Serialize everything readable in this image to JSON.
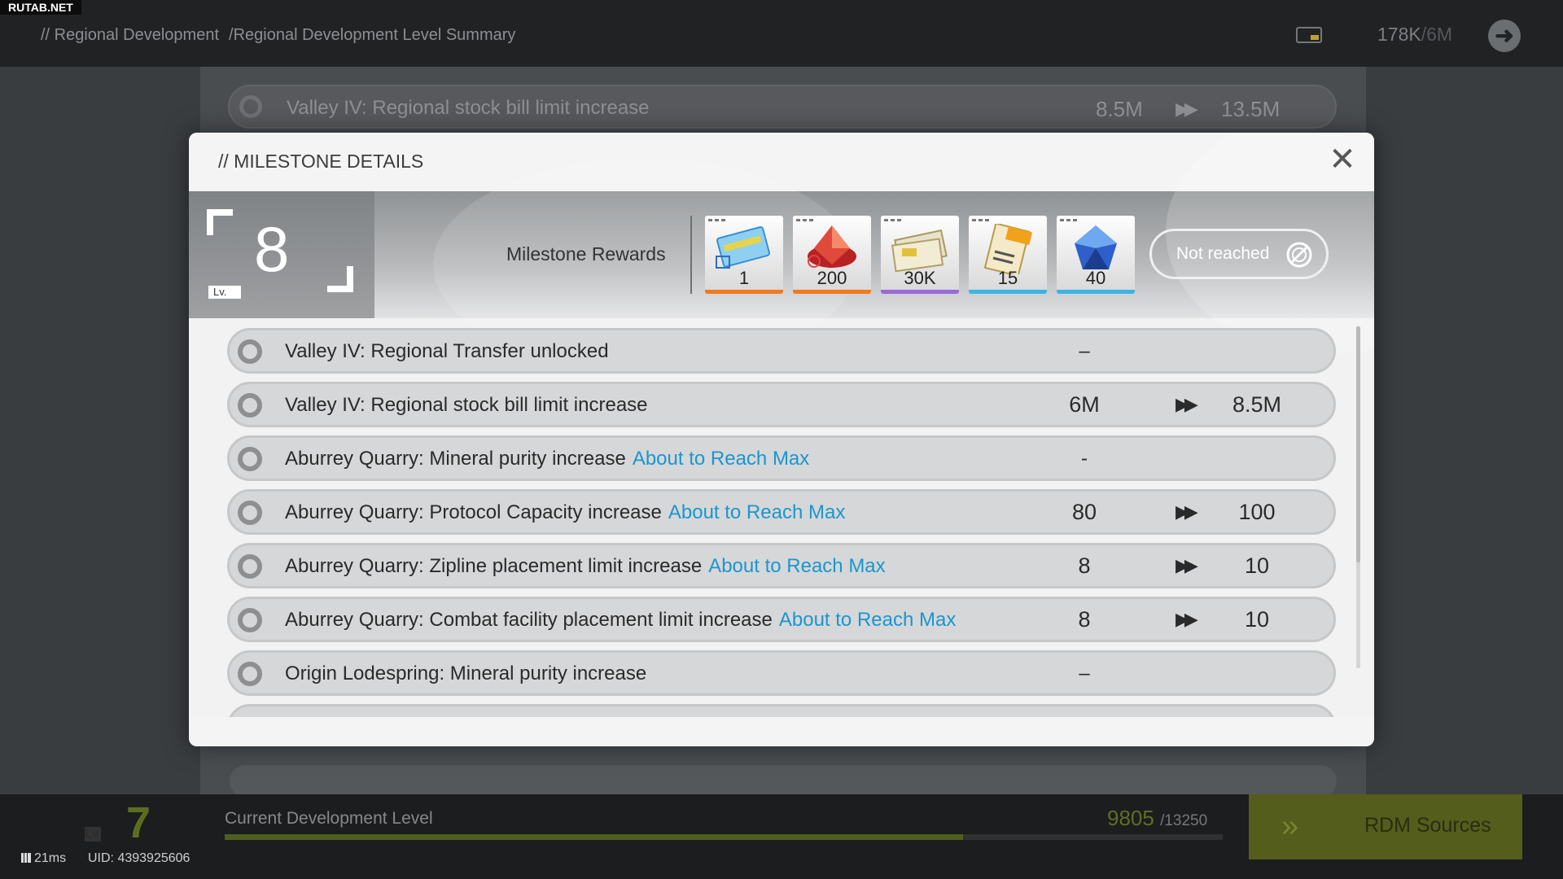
{
  "watermark": "RUTAB.NET",
  "header": {
    "breadcrumb": [
      "// Regional Development",
      "/Regional Development Level Summary"
    ],
    "stock_current": "178K",
    "stock_max": "/6M"
  },
  "background_row": {
    "label": "Valley IV: Regional stock bill limit increase",
    "from": "8.5M",
    "to": "13.5M"
  },
  "modal": {
    "title": "// MILESTONE DETAILS",
    "close_symbol": "✕",
    "level": "8",
    "level_prefix": "Lv.",
    "rewards_label": "Milestone Rewards",
    "rewards": [
      {
        "qty": "1",
        "rarity_color": "#f07a1e",
        "icon": "ticket-icon"
      },
      {
        "qty": "200",
        "rarity_color": "#f07a1e",
        "icon": "red-crystal-icon"
      },
      {
        "qty": "30K",
        "rarity_color": "#9a6ad6",
        "icon": "bill-stack-icon"
      },
      {
        "qty": "15",
        "rarity_color": "#3cb4e6",
        "icon": "exp-book-icon"
      },
      {
        "qty": "40",
        "rarity_color": "#3cb4e6",
        "icon": "blue-gem-icon"
      }
    ],
    "status": "Not reached",
    "status_icon": "prohibited-icon",
    "tag_text": "About to Reach Max",
    "rows": [
      {
        "label": "Valley IV: Regional Transfer unlocked",
        "tag": "",
        "from": "",
        "to": "",
        "dash": "–"
      },
      {
        "label": "Valley IV: Regional stock bill limit increase",
        "tag": "",
        "from": "6M",
        "to": "8.5M",
        "dash": ""
      },
      {
        "label": "Aburrey Quarry: Mineral purity increase",
        "tag": "About to Reach Max",
        "from": "",
        "to": "",
        "dash": "-"
      },
      {
        "label": "Aburrey Quarry: Protocol Capacity increase",
        "tag": "About to Reach Max",
        "from": "80",
        "to": "100",
        "dash": ""
      },
      {
        "label": "Aburrey Quarry: Zipline placement limit increase",
        "tag": "About to Reach Max",
        "from": "8",
        "to": "10",
        "dash": ""
      },
      {
        "label": "Aburrey Quarry: Combat facility placement limit increase",
        "tag": "About to Reach Max",
        "from": "8",
        "to": "10",
        "dash": ""
      },
      {
        "label": "Origin Lodespring: Mineral purity increase",
        "tag": "",
        "from": "",
        "to": "",
        "dash": "–"
      }
    ]
  },
  "footer": {
    "level_prefix": "Lv.",
    "level": "7",
    "title": "Current Development Level",
    "value": "9805",
    "max": "/13250",
    "progress": 0.74,
    "button_label": "RDM Sources",
    "ping": "21ms",
    "uid": "UID: 4393925606"
  }
}
